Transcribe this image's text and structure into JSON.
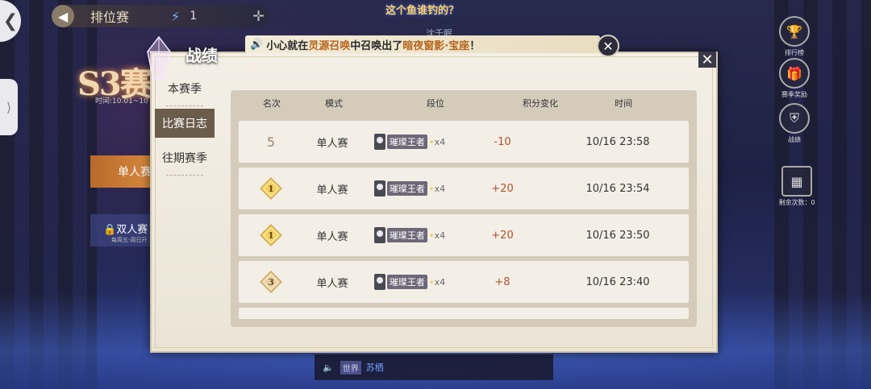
{
  "top": {
    "title": "排位赛",
    "energy_count": "1",
    "event_banner": "这个鱼谁钓的？",
    "player_name": "沈千眠"
  },
  "season": {
    "badge": "S3赛",
    "time": "时间:10.01~10"
  },
  "modes": {
    "solo": "单人赛",
    "duo": "双人赛",
    "duo_note": "每周五-周日开"
  },
  "right_icons": [
    {
      "label": "排行榜",
      "icon": "trophy-icon"
    },
    {
      "label": "赛季奖励",
      "icon": "gift-icon"
    },
    {
      "label": "战绩",
      "icon": "shield-icon"
    },
    {
      "label": "剩余次数：0",
      "icon": "box-icon"
    }
  ],
  "world_chat": {
    "tag": "世界",
    "name": "苏栖"
  },
  "notice": {
    "prefix": "小心就在",
    "place": "灵源召唤",
    "mid": "中召唤出了",
    "item": "暗夜窗影·宝座",
    "suffix": "！"
  },
  "dialog": {
    "title": "战绩",
    "nav": [
      {
        "label": "本赛季",
        "active": false
      },
      {
        "label": "比赛日志",
        "active": true
      },
      {
        "label": "往期赛季",
        "active": false
      }
    ],
    "headers": {
      "rank": "名次",
      "mode": "模式",
      "segment": "段位",
      "score_change": "积分变化",
      "time": "时间"
    },
    "rows": [
      {
        "rank": "5",
        "medal": "none",
        "mode": "单人赛",
        "segment": "璀璨王者",
        "multiplier": "x4",
        "score": "-10",
        "time": "10/16  23:58"
      },
      {
        "rank": "1",
        "medal": "gold",
        "mode": "单人赛",
        "segment": "璀璨王者",
        "multiplier": "x4",
        "score": "+20",
        "time": "10/16  23:54"
      },
      {
        "rank": "1",
        "medal": "gold",
        "mode": "单人赛",
        "segment": "璀璨王者",
        "multiplier": "x4",
        "score": "+20",
        "time": "10/16  23:50"
      },
      {
        "rank": "3",
        "medal": "bronze",
        "mode": "单人赛",
        "segment": "璀璨王者",
        "multiplier": "x4",
        "score": "+8",
        "time": "10/16  23:40"
      }
    ]
  },
  "colors": {
    "score_color": "#b0502a",
    "gold_medal": "#f2d060",
    "bronze_medal": "#e6cfa6",
    "active_nav": "#6b5c4c",
    "notice_highlight": "#b5651d"
  }
}
